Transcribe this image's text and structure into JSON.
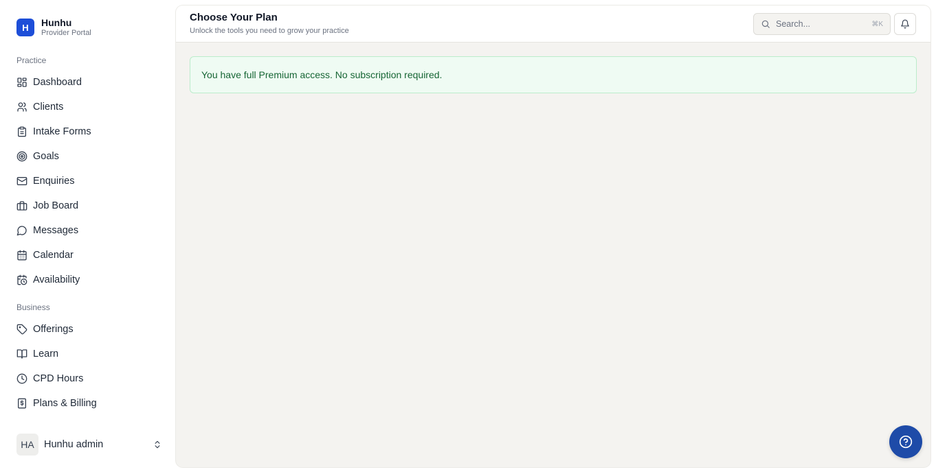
{
  "brand": {
    "logo_letter": "H",
    "name": "Hunhu",
    "subtitle": "Provider Portal",
    "color": "#1d4ed8"
  },
  "sidebar": {
    "sections": [
      {
        "label": "Practice",
        "items": [
          {
            "label": "Dashboard",
            "icon": "dashboard-icon"
          },
          {
            "label": "Clients",
            "icon": "users-icon"
          },
          {
            "label": "Intake Forms",
            "icon": "clipboard-icon"
          },
          {
            "label": "Goals",
            "icon": "target-icon"
          },
          {
            "label": "Enquiries",
            "icon": "mail-icon"
          },
          {
            "label": "Job Board",
            "icon": "briefcase-icon"
          },
          {
            "label": "Messages",
            "icon": "message-icon"
          },
          {
            "label": "Calendar",
            "icon": "calendar-icon"
          },
          {
            "label": "Availability",
            "icon": "calendar-clock-icon"
          }
        ]
      },
      {
        "label": "Business",
        "items": [
          {
            "label": "Offerings",
            "icon": "tag-icon"
          },
          {
            "label": "Learn",
            "icon": "book-icon"
          },
          {
            "label": "CPD Hours",
            "icon": "clock-icon"
          },
          {
            "label": "Plans & Billing",
            "icon": "receipt-icon"
          }
        ]
      }
    ]
  },
  "user": {
    "initials": "HA",
    "name": "Hunhu admin"
  },
  "header": {
    "title": "Choose Your Plan",
    "subtitle": "Unlock the tools you need to grow your practice",
    "search_placeholder": "Search...",
    "search_shortcut": "⌘K"
  },
  "alert": {
    "text": "You have full Premium access. No subscription required.",
    "color": "#166534",
    "background": "#effbf3"
  },
  "help_button": {
    "icon": "help-circle-icon",
    "color": "#1e4ba8"
  }
}
